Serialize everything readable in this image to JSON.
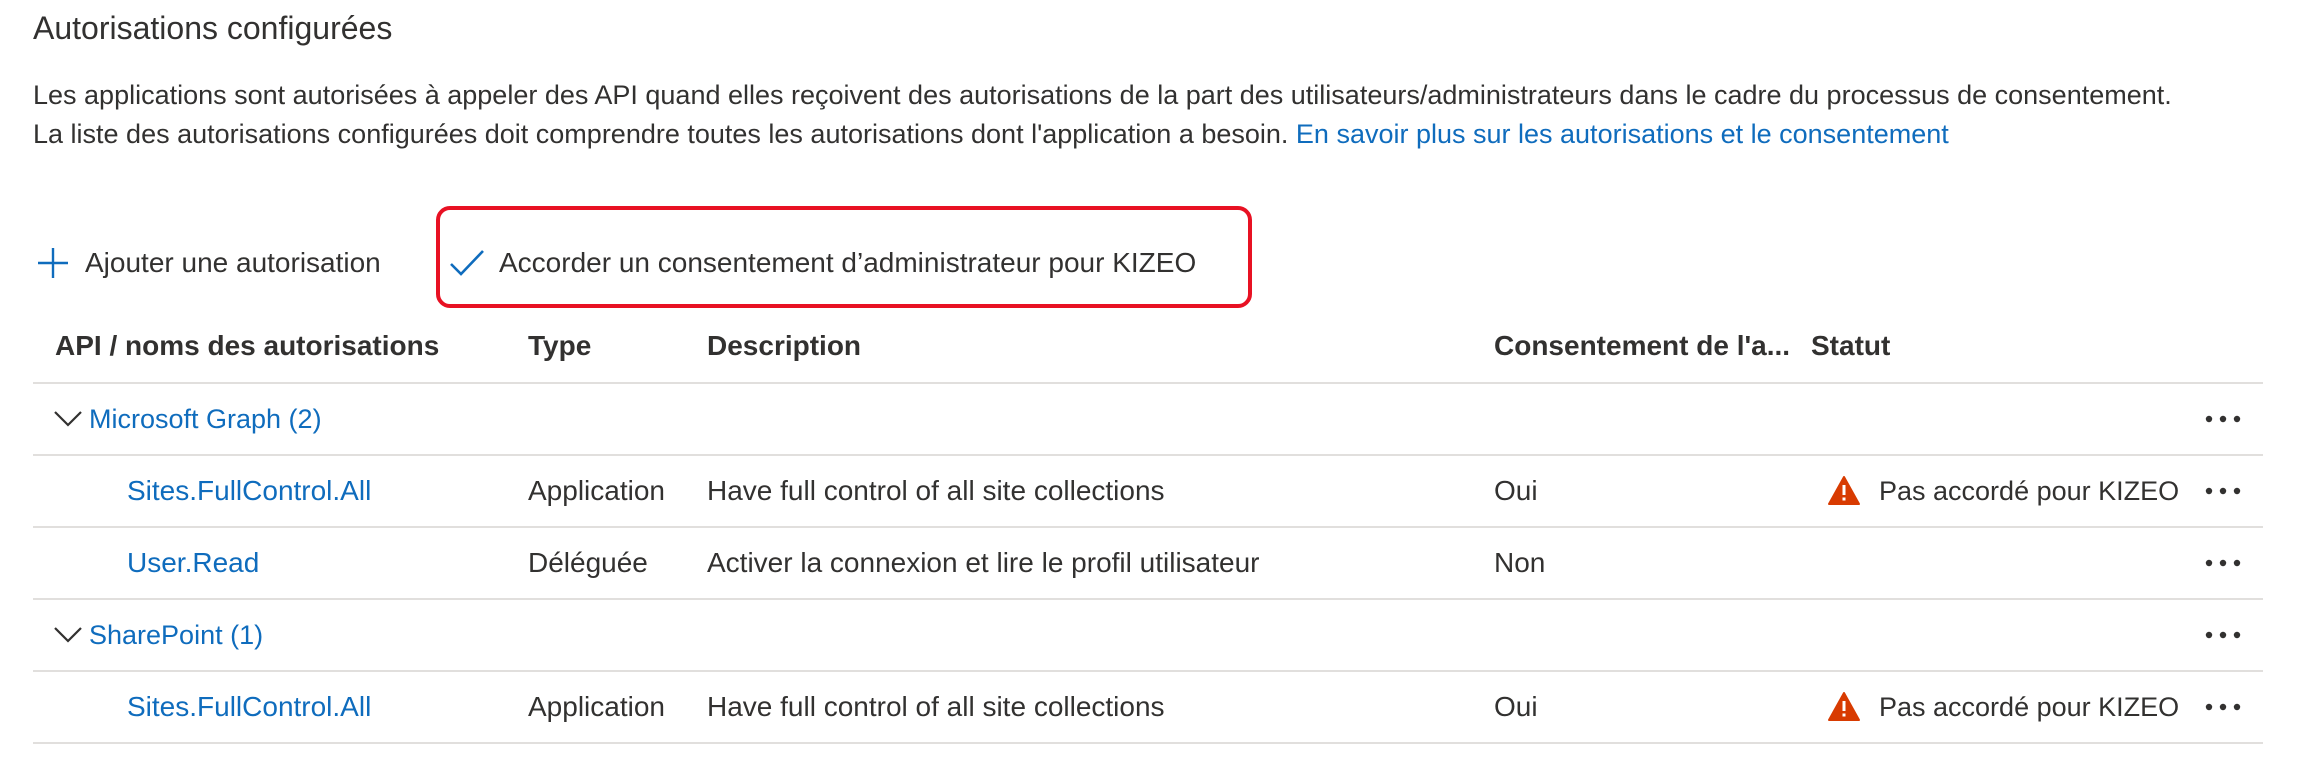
{
  "section": {
    "title": "Autorisations configurées",
    "intro_text": "Les applications sont autorisées à appeler des API quand elles reçoivent des autorisations de la part des utilisateurs/administrateurs dans le cadre du processus de consentement. La liste des autorisations configurées doit comprendre toutes les autorisations dont l'application a besoin. ",
    "learn_more_link": "En savoir plus sur les autorisations et le consentement"
  },
  "toolbar": {
    "add_permission_label": "Ajouter une autorisation",
    "add_permission_icon": "plus-icon",
    "grant_consent_label": "Accorder un consentement d’administrateur pour KIZEO",
    "grant_consent_icon": "checkmark-icon",
    "highlight_color": "#e81123"
  },
  "table": {
    "columns": {
      "api": "API / noms des autorisations",
      "type": "Type",
      "description": "Description",
      "admin_consent": "Consentement de l'a...",
      "status": "Statut"
    },
    "groups": [
      {
        "name": "Microsoft Graph (2)",
        "icon": "chevron-down-icon",
        "permissions": [
          {
            "name": "Sites.FullControl.All",
            "type": "Application",
            "description": "Have full control of all site collections",
            "admin_consent": "Oui",
            "status": "Pas accordé pour KIZEO",
            "status_icon": "warning-icon"
          },
          {
            "name": "User.Read",
            "type": "Déléguée",
            "description": "Activer la connexion et lire le profil utilisateur",
            "admin_consent": "Non",
            "status": "",
            "status_icon": ""
          }
        ]
      },
      {
        "name": "SharePoint (1)",
        "icon": "chevron-down-icon",
        "permissions": [
          {
            "name": "Sites.FullControl.All",
            "type": "Application",
            "description": "Have full control of all site collections",
            "admin_consent": "Oui",
            "status": "Pas accordé pour KIZEO",
            "status_icon": "warning-icon"
          }
        ]
      }
    ],
    "more_icon": "more-options-icon"
  },
  "colors": {
    "link": "#0f6cbd",
    "text": "#323130",
    "warning": "#d83b01",
    "divider": "#e1dfdd"
  }
}
